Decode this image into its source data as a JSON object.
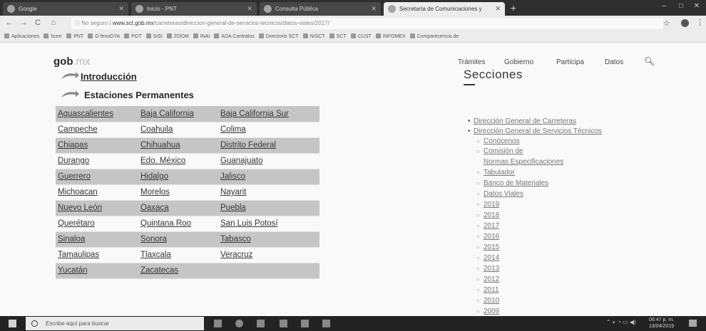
{
  "browser": {
    "tabs": [
      {
        "label": "Google",
        "active": false
      },
      {
        "label": "Inicio - PNT",
        "active": false
      },
      {
        "label": "Consulta Pública",
        "active": false
      },
      {
        "label": "Secretaría de Comunicaciones y",
        "active": true
      }
    ],
    "url_prefix": "No seguro",
    "url_host": "www.sct.gob.mx",
    "url_path": "/carreteras/direccion-general-de-servicios-tecnicos/datos-viales/2017/",
    "bookmarks": [
      "Aplicaciones",
      "hcerr",
      "PNT",
      "O fenoDYA",
      "PGT",
      "SISI",
      "ZOOM",
      "INAI",
      "ADA Contratos",
      "Directorio SCT",
      "NISCT",
      "SCT",
      "CUST",
      "INFOMEX",
      "Comparecencia de"
    ]
  },
  "header": {
    "logo_main": "gob",
    "logo_suffix": ".mx",
    "nav": [
      "Trámites",
      "Gobierno",
      "Participa",
      "Datos"
    ]
  },
  "content": {
    "intro_label": "Introducción",
    "stations_label": "Estaciones Permanentes",
    "states": [
      [
        "Aguascalientes",
        "Baja California",
        "Baja California Sur"
      ],
      [
        "Campeche",
        "Coahuila",
        "Colima"
      ],
      [
        "Chiapas",
        "Chihuahua",
        "Distrito Federal"
      ],
      [
        "Durango",
        "Edo. México",
        "Guanajuato"
      ],
      [
        "Guerrero",
        "Hidalgo",
        "Jalisco"
      ],
      [
        "Michoacan",
        "Morelos",
        "Nayarit"
      ],
      [
        "Nuevo León",
        "Oaxaca",
        "Puebla"
      ],
      [
        "Querétaro",
        "Quintana Roo",
        "San Luis Potosí"
      ],
      [
        "Sinaloa",
        "Sonora",
        "Tabasco"
      ],
      [
        "Tamaulipas",
        "Tlaxcala",
        "Veracruz"
      ],
      [
        "Yucatán",
        "Zacatecas",
        ""
      ]
    ]
  },
  "sidebar": {
    "title": "Secciones",
    "top_items": [
      "Dirección General de Carreteras",
      "Dirección General de Servicios Técnicos"
    ],
    "sub_items": [
      "Conócenos",
      "Comisión de",
      "Normas Especificaciones",
      "Tabulador",
      "Banco de Materiales",
      "Datos Viales",
      "2019",
      "2018",
      "2017",
      "2016",
      "2015",
      "2014",
      "2013",
      "2012",
      "2011",
      "2010",
      "2009"
    ]
  },
  "taskbar": {
    "search_placeholder": "Escribe aquí para buscar",
    "time": "06:47 p. m.",
    "date": "13/04/2019"
  }
}
